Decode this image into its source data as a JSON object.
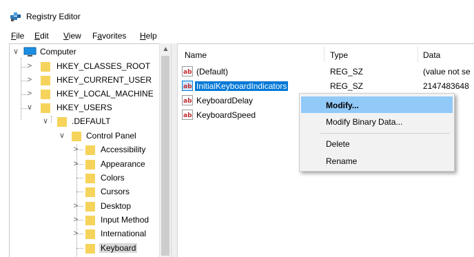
{
  "window": {
    "title": "Registry Editor"
  },
  "menubar": [
    {
      "label": "File",
      "accel": "F",
      "rest": "ile"
    },
    {
      "label": "Edit",
      "accel": "E",
      "rest": "dit"
    },
    {
      "label": "View",
      "accel": "V",
      "rest": "iew"
    },
    {
      "label": "Favorites",
      "pre": "F",
      "accel": "a",
      "rest": "vorites"
    },
    {
      "label": "Help",
      "accel": "H",
      "rest": "elp"
    }
  ],
  "tree": {
    "root": "Computer",
    "hives": [
      "HKEY_CLASSES_ROOT",
      "HKEY_CURRENT_USER",
      "HKEY_LOCAL_MACHINE",
      "HKEY_USERS"
    ],
    "default_key": ".DEFAULT",
    "control_panel": "Control Panel",
    "children": [
      "Accessibility",
      "Appearance",
      "Colors",
      "Cursors",
      "Desktop",
      "Input Method",
      "International",
      "Keyboard"
    ],
    "selected": "Keyboard"
  },
  "list": {
    "columns": {
      "name": "Name",
      "type": "Type",
      "data": "Data"
    },
    "rows": [
      {
        "name": "(Default)",
        "type": "REG_SZ",
        "data": "(value not se"
      },
      {
        "name": "InitialKeyboardIndicators",
        "type": "REG_SZ",
        "data": "2147483648"
      },
      {
        "name": "KeyboardDelay",
        "type": "",
        "data": ""
      },
      {
        "name": "KeyboardSpeed",
        "type": "",
        "data": ""
      }
    ],
    "selected_index": 1
  },
  "context_menu": {
    "items": [
      "Modify...",
      "Modify Binary Data...",
      "Delete",
      "Rename"
    ],
    "highlighted": "Modify..."
  },
  "colors": {
    "selection": "#0078d7",
    "menu_highlight": "#91c9f7",
    "folder": "#f6d35b"
  }
}
